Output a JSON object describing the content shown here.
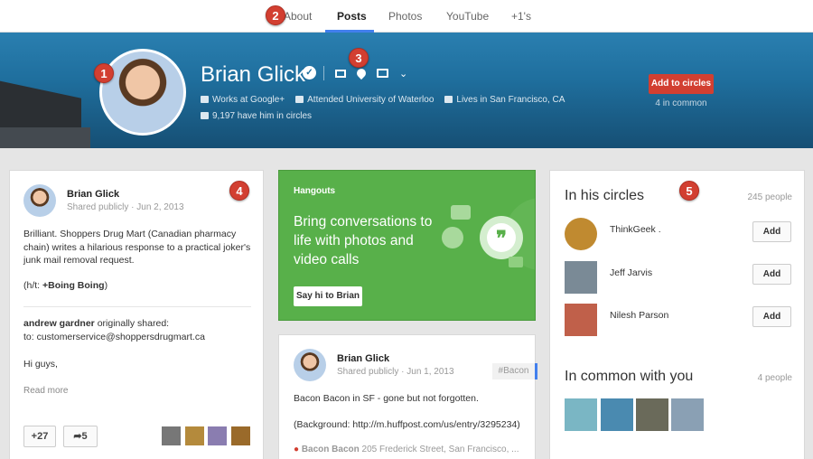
{
  "topnav": {
    "tabs": [
      "About",
      "Posts",
      "Photos",
      "YouTube",
      "+1's"
    ],
    "active": "Posts"
  },
  "profile": {
    "name": "Brian Glick",
    "works": "Works at Google+",
    "school": "Attended University of Waterloo",
    "lives": "Lives in San Francisco, CA",
    "circles": "9,197 have him in circles",
    "add_button": "Add to circles",
    "in_common": "4 in common"
  },
  "badges": [
    "1",
    "2",
    "3",
    "4",
    "5"
  ],
  "post1": {
    "author": "Brian Glick",
    "sub": "Shared publicly  ·  Jun 2, 2013",
    "text1": "Brilliant. Shoppers Drug Mart (Canadian pharmacy chain) writes a hilarious response to a practical joker's junk mail removal request.",
    "ht_prefix": "(h/t: ",
    "ht_link": "+Boing Boing",
    "ht_suffix": ")",
    "shared_name": "andrew gardner",
    "shared_suffix": " originally shared:",
    "to_line": "to: customerservice@shoppersdrugmart.ca",
    "hi": "Hi guys,",
    "read_more": "Read more",
    "plus_count": "+27",
    "share_count": "5"
  },
  "hangouts": {
    "title": "Hangouts",
    "text": "Bring conversations to life with photos and video calls",
    "button": "Say hi to Brian"
  },
  "post2": {
    "author": "Brian Glick",
    "sub": "Shared publicly  ·  Jun 1, 2013",
    "hashtag": "#Bacon",
    "text1": "Bacon Bacon in SF - gone but not forgotten.",
    "text2": "(Background: http://m.huffpost.com/us/entry/3295234)",
    "place_name": "Bacon Bacon",
    "place_addr": " 205 Frederick Street, San Francisco, ..."
  },
  "circles": {
    "title": "In his circles",
    "count": "245 people",
    "people": [
      {
        "name": "ThinkGeek .",
        "button": "Add"
      },
      {
        "name": "Jeff Jarvis",
        "button": "Add"
      },
      {
        "name": "Nilesh Parson",
        "button": "Add"
      }
    ],
    "common_title": "In common with you",
    "common_count": "4 people"
  },
  "colors": {
    "accent_red": "#d23f31",
    "nav_blue": "#427fed",
    "hangouts_green": "#58b04a"
  }
}
